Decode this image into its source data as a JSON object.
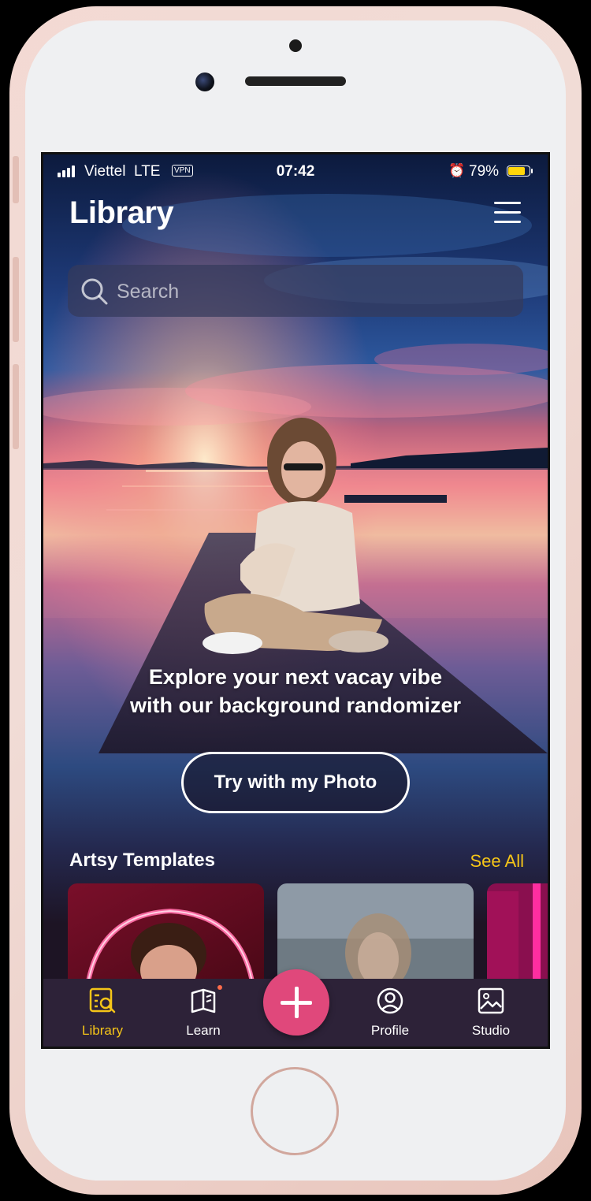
{
  "status_bar": {
    "carrier": "Viettel",
    "network": "LTE",
    "vpn": "VPN",
    "time": "07:42",
    "battery_percent": "79%",
    "battery_level": 0.79,
    "battery_color": "#ffd60a"
  },
  "header": {
    "title": "Library",
    "menu_icon": "hamburger-menu-icon"
  },
  "search": {
    "placeholder": "Search"
  },
  "hero": {
    "tagline_line1": "Explore your next vacay vibe",
    "tagline_line2": "with our background randomizer",
    "cta_label": "Try with my Photo"
  },
  "templates": {
    "section_title": "Artsy Templates",
    "see_all_label": "See All"
  },
  "tabbar": {
    "items": [
      {
        "label": "Library",
        "icon": "library-icon",
        "active": true
      },
      {
        "label": "Learn",
        "icon": "book-icon",
        "active": false,
        "has_badge": true
      },
      {
        "label": "Profile",
        "icon": "user-circle-icon",
        "active": false
      },
      {
        "label": "Studio",
        "icon": "image-icon",
        "active": false
      }
    ],
    "fab_icon": "plus-icon"
  },
  "colors": {
    "accent": "#f5c518",
    "fab": "#e0487b",
    "tabbar_bg": "#2d2238",
    "screen_bg": "#1d1424"
  }
}
